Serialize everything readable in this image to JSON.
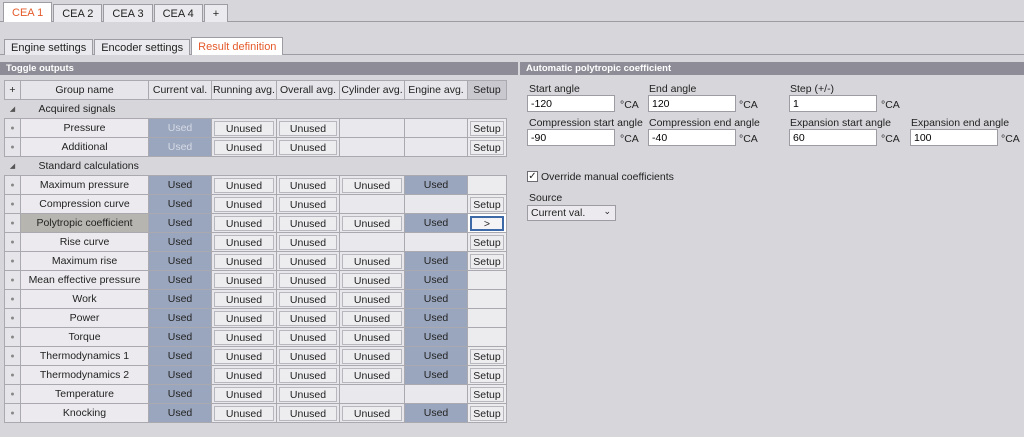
{
  "top_tabs": [
    "CEA 1",
    "CEA 2",
    "CEA 3",
    "CEA 4",
    "+"
  ],
  "sub_tabs": [
    "Engine settings",
    "Encoder settings",
    "Result definition"
  ],
  "toggle_panel": {
    "title": "Toggle outputs",
    "add": "+",
    "headers": [
      "Group name",
      "Current val.",
      "Running avg.",
      "Overall avg.",
      "Cylinder avg.",
      "Engine avg.",
      "Setup"
    ],
    "groups": [
      {
        "name": "Acquired signals",
        "rows": [
          {
            "name": "Pressure",
            "cells": [
              "Used",
              "Unused",
              "Unused",
              "",
              "",
              "Setup"
            ]
          },
          {
            "name": "Additional",
            "cells": [
              "Used",
              "Unused",
              "Unused",
              "",
              "",
              "Setup"
            ]
          }
        ]
      },
      {
        "name": "Standard calculations",
        "rows": [
          {
            "name": "Maximum pressure",
            "cells": [
              "Used",
              "Unused",
              "Unused",
              "Unused",
              "Used",
              ""
            ]
          },
          {
            "name": "Compression curve",
            "cells": [
              "Used",
              "Unused",
              "Unused",
              "",
              "",
              "Setup"
            ]
          },
          {
            "name": "Polytropic coefficient",
            "cells": [
              "Used",
              "Unused",
              "Unused",
              "Unused",
              "Used",
              ">"
            ]
          },
          {
            "name": "Rise curve",
            "cells": [
              "Used",
              "Unused",
              "Unused",
              "",
              "",
              "Setup"
            ]
          },
          {
            "name": "Maximum rise",
            "cells": [
              "Used",
              "Unused",
              "Unused",
              "Unused",
              "Used",
              "Setup"
            ]
          },
          {
            "name": "Mean effective pressure",
            "cells": [
              "Used",
              "Unused",
              "Unused",
              "Unused",
              "Used",
              ""
            ]
          },
          {
            "name": "Work",
            "cells": [
              "Used",
              "Unused",
              "Unused",
              "Unused",
              "Used",
              ""
            ]
          },
          {
            "name": "Power",
            "cells": [
              "Used",
              "Unused",
              "Unused",
              "Unused",
              "Used",
              ""
            ]
          },
          {
            "name": "Torque",
            "cells": [
              "Used",
              "Unused",
              "Unused",
              "Unused",
              "Used",
              ""
            ]
          },
          {
            "name": "Thermodynamics 1",
            "cells": [
              "Used",
              "Unused",
              "Unused",
              "Unused",
              "Used",
              "Setup"
            ]
          },
          {
            "name": "Thermodynamics 2",
            "cells": [
              "Used",
              "Unused",
              "Unused",
              "Unused",
              "Used",
              "Setup"
            ]
          },
          {
            "name": "Temperature",
            "cells": [
              "Used",
              "Unused",
              "Unused",
              "",
              "",
              "Setup"
            ]
          },
          {
            "name": "Knocking",
            "cells": [
              "Used",
              "Unused",
              "Unused",
              "Unused",
              "Used",
              "Setup"
            ]
          }
        ]
      }
    ]
  },
  "poly_panel": {
    "title": "Automatic polytropic coefficient",
    "fields": {
      "start_angle": {
        "label": "Start angle",
        "value": "-120",
        "unit": "°CA"
      },
      "end_angle": {
        "label": "End angle",
        "value": "120",
        "unit": "°CA"
      },
      "step": {
        "label": "Step (+/-)",
        "value": "1",
        "unit": "°CA"
      },
      "comp_start": {
        "label": "Compression start angle",
        "value": "-90",
        "unit": "°CA"
      },
      "comp_end": {
        "label": "Compression end angle",
        "value": "-40",
        "unit": "°CA"
      },
      "exp_start": {
        "label": "Expansion start angle",
        "value": "60",
        "unit": "°CA"
      },
      "exp_end": {
        "label": "Expansion end angle",
        "value": "100",
        "unit": "°CA"
      }
    },
    "override_label": "Override manual coefficients",
    "override_checked": "✓",
    "source_label": "Source",
    "source_value": "Current val."
  }
}
